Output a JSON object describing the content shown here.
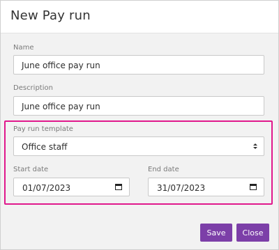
{
  "dialog": {
    "title": "New Pay run"
  },
  "form": {
    "name": {
      "label": "Name",
      "value": "June office pay run"
    },
    "description": {
      "label": "Description",
      "value": "June office pay run"
    },
    "template": {
      "label": "Pay run template",
      "value": "Office staff"
    },
    "start_date": {
      "label": "Start date",
      "value": "01/07/2023"
    },
    "end_date": {
      "label": "End date",
      "value": "31/07/2023"
    }
  },
  "buttons": {
    "save": "Save",
    "close": "Close"
  },
  "colors": {
    "accent": "#7c3fa8",
    "highlight": "#e0188c"
  }
}
